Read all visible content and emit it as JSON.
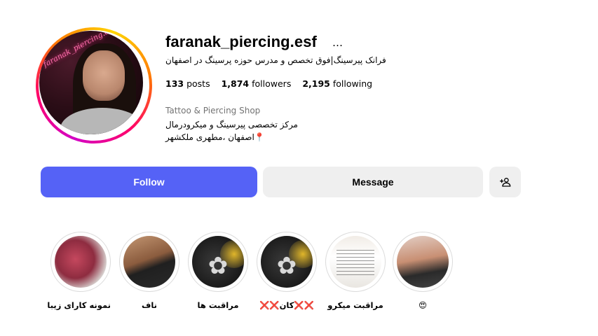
{
  "profile": {
    "username": "faranak_piercing.esf",
    "more_icon": "…",
    "full_name": "فرانک پیرسینگ|فوق تخصص و مدرس حوزه پرسینگ در اصفهان",
    "avatar_neon_text": "faranak_piercing.esf",
    "category": "Tattoo & Piercing Shop",
    "bio_line1": "مرکز تخصصی پیرسینگ و میکرودرمال",
    "bio_line2": "📍اصفهان ،مطهری ملکشهر"
  },
  "stats": [
    {
      "count": "133",
      "label": "posts"
    },
    {
      "count": "1,874",
      "label": "followers"
    },
    {
      "count": "2,195",
      "label": "following"
    }
  ],
  "actions": {
    "follow": "Follow",
    "message": "Message",
    "add_user_icon": "person-add-icon"
  },
  "highlights": [
    {
      "label": "نمونه کارای زیبا",
      "icon": "earring-photo"
    },
    {
      "label": "ناف",
      "icon": "navel-photo"
    },
    {
      "label": "مراقبت ها",
      "icon": "flower-jewelry-photo"
    },
    {
      "label": "❌❌کان❌❌",
      "icon": "flower-jewelry-photo"
    },
    {
      "label": "مراقبت میکرو",
      "icon": "text-card-photo"
    },
    {
      "label": "😍",
      "icon": "belly-photo"
    }
  ],
  "colors": {
    "follow_bg": "#5562f6",
    "secondary_bg": "#efefef",
    "category_text": "#737373"
  }
}
